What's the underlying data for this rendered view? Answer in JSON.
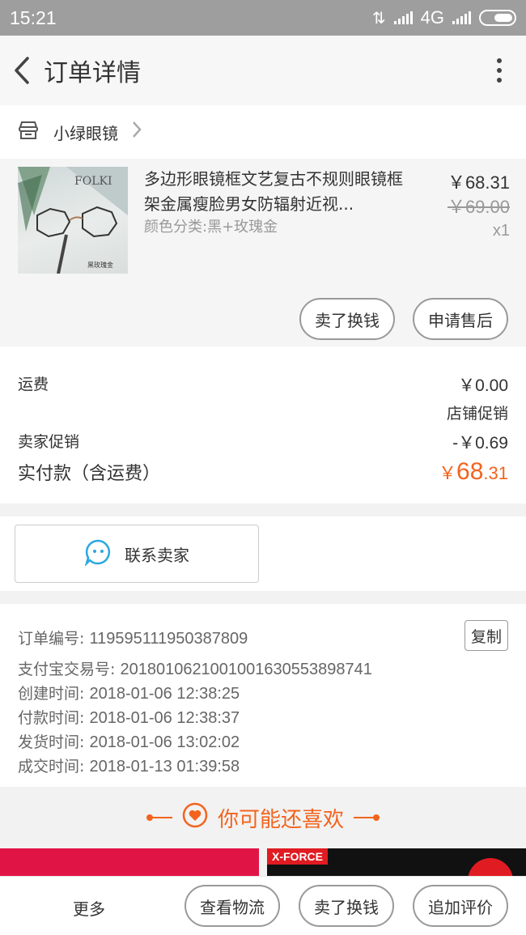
{
  "status_bar": {
    "time": "15:21",
    "network": "4G"
  },
  "nav": {
    "title": "订单详情"
  },
  "shop": {
    "name": "小绿眼镜"
  },
  "item": {
    "title": "多边形眼镜框文艺复古不规则眼镜框架金属瘦脸男女防辐射近视...",
    "sku": "颜色分类:黑+玫瑰金",
    "price": "￥68.31",
    "original_price": "￥69.00",
    "quantity": "x1",
    "thumb_text": "FOLKI",
    "thumb_caption": "黑玫瑰金"
  },
  "item_actions": {
    "exchange": "卖了换钱",
    "after_sale": "申请售后"
  },
  "fees": {
    "shipping_label": "运费",
    "shipping_value": "￥0.00",
    "shop_promo_label": "店铺促销",
    "seller_promo_label": "卖家促销",
    "seller_promo_value": "-￥0.69",
    "total_label": "实付款（含运费）",
    "total_currency": "￥",
    "total_int": "68",
    "total_dec": ".31"
  },
  "contact": {
    "label": "联系卖家"
  },
  "order_info": {
    "order_no_label": "订单编号: ",
    "order_no": "119595111950387809",
    "copy_label": "复制",
    "alipay_label": "支付宝交易号: ",
    "alipay_no": "2018010621001001630553898741",
    "created_label": "创建时间: ",
    "created": "2018-01-06 12:38:25",
    "paid_label": "付款时间: ",
    "paid": "2018-01-06 12:38:37",
    "shipped_label": "发货时间: ",
    "shipped": "2018-01-06 13:02:02",
    "closed_label": "成交时间: ",
    "closed": "2018-01-13 01:39:58"
  },
  "recommend": {
    "title": "你可能还喜欢",
    "right_tag": "X-FORCE"
  },
  "bottom_bar": {
    "more": "更多",
    "logistics": "查看物流",
    "exchange": "卖了换钱",
    "review": "追加评价"
  },
  "colors": {
    "accent": "#f2641e",
    "contact_icon": "#2aa8e0"
  }
}
